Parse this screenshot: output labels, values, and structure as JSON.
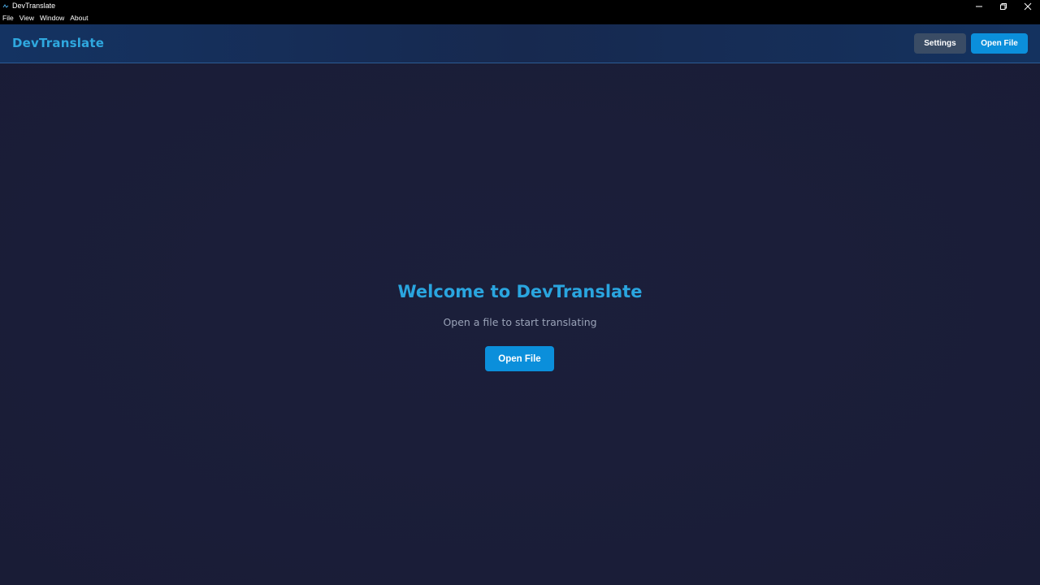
{
  "window": {
    "title": "DevTranslate",
    "icon": "app-icon"
  },
  "menu": {
    "items": [
      "File",
      "View",
      "Window",
      "About"
    ]
  },
  "header": {
    "brand": "DevTranslate",
    "settings_label": "Settings",
    "open_file_label": "Open File"
  },
  "main": {
    "title": "Welcome to DevTranslate",
    "subtitle": "Open a file to start translating",
    "open_file_label": "Open File"
  },
  "colors": {
    "accent": "#0b8fdb",
    "brand_text": "#2fa8df",
    "background": "#1a1d35",
    "settings_button": "#3a4c65"
  }
}
